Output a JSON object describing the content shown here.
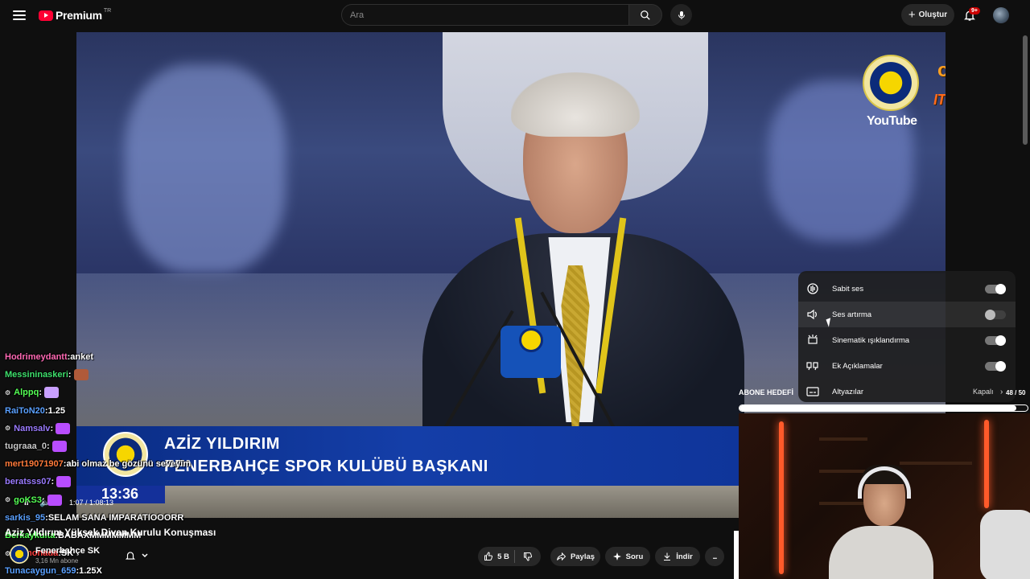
{
  "header": {
    "logo_text": "Premium",
    "logo_region": "TR",
    "search_placeholder": "Ara",
    "create_label": "Oluştur",
    "notification_count": "9+",
    "icons": [
      "menu-icon",
      "search-icon",
      "mic-icon",
      "plus-icon",
      "bell-icon",
      "avatar"
    ]
  },
  "video": {
    "watermark_youtube": "YouTube",
    "watermark_oyun": "oyunfo",
    "watermark_itopya": "ITOPYA.COM",
    "lower_third": {
      "name": "AZİZ YILDIRIM",
      "title": "FENERBAHÇE SPOR KULÜBÜ BAŞKANI",
      "time": "13:36"
    },
    "player": {
      "pause_label": "II",
      "current_time": "1:07 / 1:08:13"
    }
  },
  "settings_menu": {
    "items": [
      {
        "label": "Sabit ses",
        "icon": "stable-volume-icon",
        "toggle": "on"
      },
      {
        "label": "Ses artırma",
        "icon": "volume-boost-icon",
        "toggle": "off"
      },
      {
        "label": "Sinematik ışıklandırma",
        "icon": "ambient-mode-icon",
        "toggle": "on"
      },
      {
        "label": "Ek Açıklamalar",
        "icon": "annotations-icon",
        "toggle": "on"
      },
      {
        "label": "Altyazılar",
        "icon": "subtitles-icon",
        "value": "Kapalı"
      }
    ]
  },
  "subscriber_goal": {
    "label": "ABONE HEDEFİ",
    "count": "48 / 50",
    "progress": 0.96
  },
  "chat": {
    "lines": [
      {
        "user": "Hodrimeydantt",
        "color": "#ff69b4",
        "message": "anket",
        "badge": ""
      },
      {
        "user": "Messininaskeri",
        "color": "#3ee06c",
        "message": "",
        "badge": "",
        "emote": "#b05a3a"
      },
      {
        "user": "Alppq",
        "color": "#55ff55",
        "message": "",
        "badge": "⚙",
        "emote": "#c9a0ff"
      },
      {
        "user": "RaiToN20",
        "color": "#5aa0ff",
        "message": "1.25",
        "badge": ""
      },
      {
        "user": "Namsalv",
        "color": "#9b7bff",
        "message": "",
        "badge": "⚙",
        "emote": "#b84dff"
      },
      {
        "user": "tugraaa_0",
        "color": "#c7c7c7",
        "message": "",
        "badge": "",
        "emote": "#b84dff"
      },
      {
        "user": "mert19071907",
        "color": "#ff7a3a",
        "message": "abi olmaz be gözünü seveyim",
        "badge": ""
      },
      {
        "user": "beratsss07",
        "color": "#9b7bff",
        "message": "",
        "badge": "",
        "emote": "#b84dff"
      },
      {
        "user": "goKS3",
        "color": "#55ff55",
        "message": "",
        "badge": "⚙",
        "emote": "#b84dff"
      },
      {
        "user": "sarkis_95",
        "color": "#5aa0ff",
        "message": "SELAM SANA IMPARATIOOORR",
        "badge": ""
      },
      {
        "user": "Berkaykulta",
        "color": "#55ff55",
        "message": "BABAXMMMMMMM",
        "badge": ""
      },
      {
        "user": "Lemonada",
        "color": "#ff4040",
        "message": "SK",
        "badge": "⚙"
      },
      {
        "user": "Tunacaygun_659",
        "color": "#5aa0ff",
        "message": "1.25X",
        "badge": ""
      }
    ]
  },
  "video_info": {
    "title": "Aziz Yıldırım Yüksek Divan Kurulu Konuşması",
    "channel_name": "Fenerbahçe SK",
    "subscribers": "3,16 Mn abone",
    "like_count": "5 B",
    "share_label": "Paylaş",
    "ask_label": "Soru",
    "download_label": "İndir",
    "more_label": "..."
  }
}
